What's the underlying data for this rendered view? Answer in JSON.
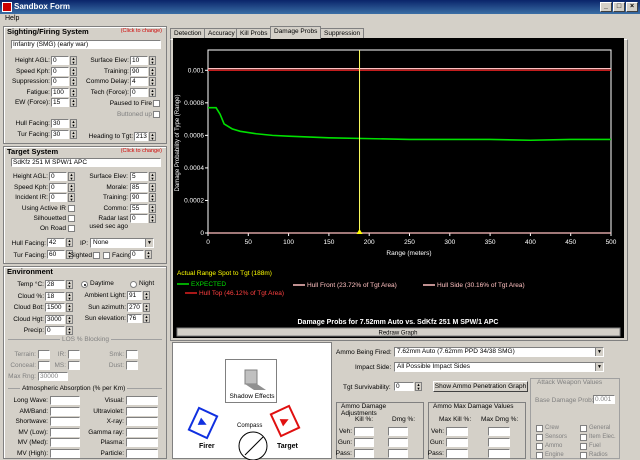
{
  "window": {
    "title": "Sandbox Form",
    "menu": [
      "Help"
    ]
  },
  "sighting": {
    "title": "Sighting/Firing System",
    "click_hint": "(Click to change)",
    "unit": "Infantry (SMG) (early war)",
    "left_fields": [
      {
        "label": "Height AGL:",
        "value": "0"
      },
      {
        "label": "Speed Kph:",
        "value": "0"
      },
      {
        "label": "Suppression:",
        "value": "0"
      },
      {
        "label": "Fatigue:",
        "value": "100"
      },
      {
        "label": "EW (Force):",
        "value": "15"
      }
    ],
    "right_fields": [
      {
        "label": "Surface Elev:",
        "value": "10"
      },
      {
        "label": "Training:",
        "value": "90"
      },
      {
        "label": "Commo Delay:",
        "value": "4"
      },
      {
        "label": "Tech (Force):",
        "value": "0"
      }
    ],
    "paused_label": "Paused to Fire",
    "buttoned_label": "Buttoned up",
    "hull_facing": {
      "label": "Hull Facing:",
      "value": "30"
    },
    "tur_facing": {
      "label": "Tur Facing:",
      "value": "30"
    },
    "heading": {
      "label": "Heading to Tgt:",
      "value": "213"
    }
  },
  "target": {
    "title": "Target System",
    "click_hint": "(Click to change)",
    "unit": "SdKfz 251 M SPW/1 APC",
    "left_fields": [
      {
        "label": "Height AGL:",
        "value": "0"
      },
      {
        "label": "Speed Kph:",
        "value": "0"
      },
      {
        "label": "Incident IR:",
        "value": "0"
      }
    ],
    "right_fields": [
      {
        "label": "Surface Elev:",
        "value": "5"
      },
      {
        "label": "Morale:",
        "value": "85"
      },
      {
        "label": "Training:",
        "value": "90"
      },
      {
        "label": "Commo:",
        "value": "55"
      },
      {
        "label": "Radar last",
        "value": "0"
      }
    ],
    "using_active_ir": "Using Active IR",
    "silhouetted": "Silhouetted",
    "on_road": "On Road",
    "used_sec_ago": "used sec ago",
    "hull_facing": {
      "label": "Hull Facing:",
      "value": "42"
    },
    "tur_facing": {
      "label": "Tur Facing:",
      "value": "60"
    },
    "ip_label": "IP:",
    "ip_value": "None",
    "sighted": "Sighted",
    "facing_label": "Facing",
    "facing_value": "0"
  },
  "environment": {
    "title": "Environment",
    "fields": [
      {
        "label": "Temp °C:",
        "value": "28"
      },
      {
        "label": "Cloud %:",
        "value": "18"
      },
      {
        "label": "Cloud Bot:",
        "value": "1500"
      },
      {
        "label": "Cloud Hgt:",
        "value": "3000"
      },
      {
        "label": "Precip:",
        "value": "0"
      }
    ],
    "daytime": "Daytime",
    "night": "Night",
    "right_fields": [
      {
        "label": "Ambient Light:",
        "value": "91"
      },
      {
        "label": "Sun azimuth:",
        "value": "270"
      },
      {
        "label": "Sun elevation:",
        "value": "76"
      }
    ],
    "los_title": "LOS % Blocking",
    "los_fields": [
      "Terrain:",
      "Conceal:",
      "Max Rng:"
    ],
    "los_ir": "IR:",
    "los_ms": "MS:",
    "los_smk": "Smk:",
    "los_dust": "Dust:",
    "max_rng_value": "30000",
    "absorption_title": "Atmospheric Absorption (% per Km)",
    "absorption_left": [
      "Long Wave:",
      "AM/Band:",
      "Shortwave:",
      "MV (Low):",
      "MV (Med):",
      "MV (High):"
    ],
    "absorption_right": [
      "Visual:",
      "Ultraviolet:",
      "X-ray:",
      "Gamma ray:",
      "Plasma:",
      "Particle:"
    ]
  },
  "tabs": [
    {
      "label": "Detection"
    },
    {
      "label": "Accuracy"
    },
    {
      "label": "Kill Probs"
    },
    {
      "label": "Damage Probs"
    },
    {
      "label": "Suppression"
    }
  ],
  "compass": {
    "shadow_effects": "Shadow Effects",
    "compass_label": "Compass",
    "firer_label": "Firer",
    "target_label": "Target"
  },
  "controls": {
    "ammo_label": "Ammo Being Fired:",
    "ammo_value": "7.62mm Auto (7.62mm PPD 34/38 SMG)",
    "impact_label": "Impact Side:",
    "impact_value": "All Possible Impact Sides",
    "survivability_label": "Tgt Survivability:",
    "survivability_value": "0",
    "penetration_button": "Show Ammo Penetration Graph",
    "dmg_adj_title": "Ammo Damage Adjustments",
    "max_dmg_title": "Ammo Max Damage Values",
    "kill_label": "Kill %:",
    "dmg_label": "Dmg %:",
    "max_kill_label": "Max Kill %:",
    "max_dmg_label": "Max Dmg %:",
    "row_labels": [
      "Veh:",
      "Gun:",
      "Pass:"
    ],
    "gray_box_title": "Attack Weapon Values",
    "gray_field_label": "Base Damage Prob:",
    "gray_field_value": "0.001",
    "checks": [
      "Crew",
      "General",
      "Sensors",
      "Item Elec.",
      "Ammo",
      "Fuel",
      "Engine",
      "Radios"
    ]
  },
  "chart_data": {
    "type": "line",
    "x_tick_labels": [
      "0",
      "50",
      "100",
      "150",
      "200",
      "250",
      "300",
      "350",
      "400",
      "450",
      "500"
    ],
    "y_tick_labels": [
      "0.001",
      "0.0008",
      "0.0006",
      "0.0004",
      "0.0002",
      "0"
    ],
    "ylabel": "Damage Probability of Type (Range)",
    "xlabel": "Range (meters)",
    "xlim": [
      0,
      500
    ],
    "ylim": [
      0,
      0.0011
    ],
    "marker": {
      "x": 188
    },
    "range_spot_label": "Actual Range Spot to Tgt (188m)",
    "legend": [
      {
        "name": "EXPECTED",
        "color": "#00e000"
      },
      {
        "name": "Hull Front (23.72% of Tgt Area)",
        "color": "#ffc0c0"
      },
      {
        "name": "Hull Side (30.16% of Tgt Area)",
        "color": "#ffc0c0"
      },
      {
        "name": "Hull Top (46.12% of Tgt Area)",
        "color": "#e02020"
      }
    ],
    "title": "Damage Probs for  7.52mm Auto  vs.  SdKfz 251 M SPW/1 APC",
    "redraw": "Redraw Graph",
    "series": [
      {
        "name": "EXPECTED",
        "color": "#00e000",
        "x": [
          0,
          10,
          15,
          20,
          30,
          40,
          60,
          80,
          100,
          150,
          200,
          250,
          300,
          350,
          400,
          450,
          500
        ],
        "y": [
          0.00077,
          0.00077,
          0.00073,
          0.00067,
          0.00064,
          0.000625,
          0.00061,
          0.0006,
          0.000595,
          0.000585,
          0.00058,
          0.000575,
          0.000575,
          0.000575,
          0.00057,
          0.000575,
          0.000575
        ]
      },
      {
        "name": "Hull Top (46.12% of Tgt Area)",
        "color": "#e02020",
        "x": [
          0,
          500
        ],
        "y": [
          0.001,
          0.001
        ]
      },
      {
        "name": "Hull Front (23.72% of Tgt Area)",
        "color": "#ffc0c0",
        "x": [
          0,
          500
        ],
        "y": [
          0.00101,
          0.00101
        ]
      },
      {
        "name": "Hull Side (30.16% of Tgt Area)",
        "color": "#ffc0c0",
        "x": [
          0,
          500
        ],
        "y": [
          0,
          0
        ]
      }
    ]
  }
}
